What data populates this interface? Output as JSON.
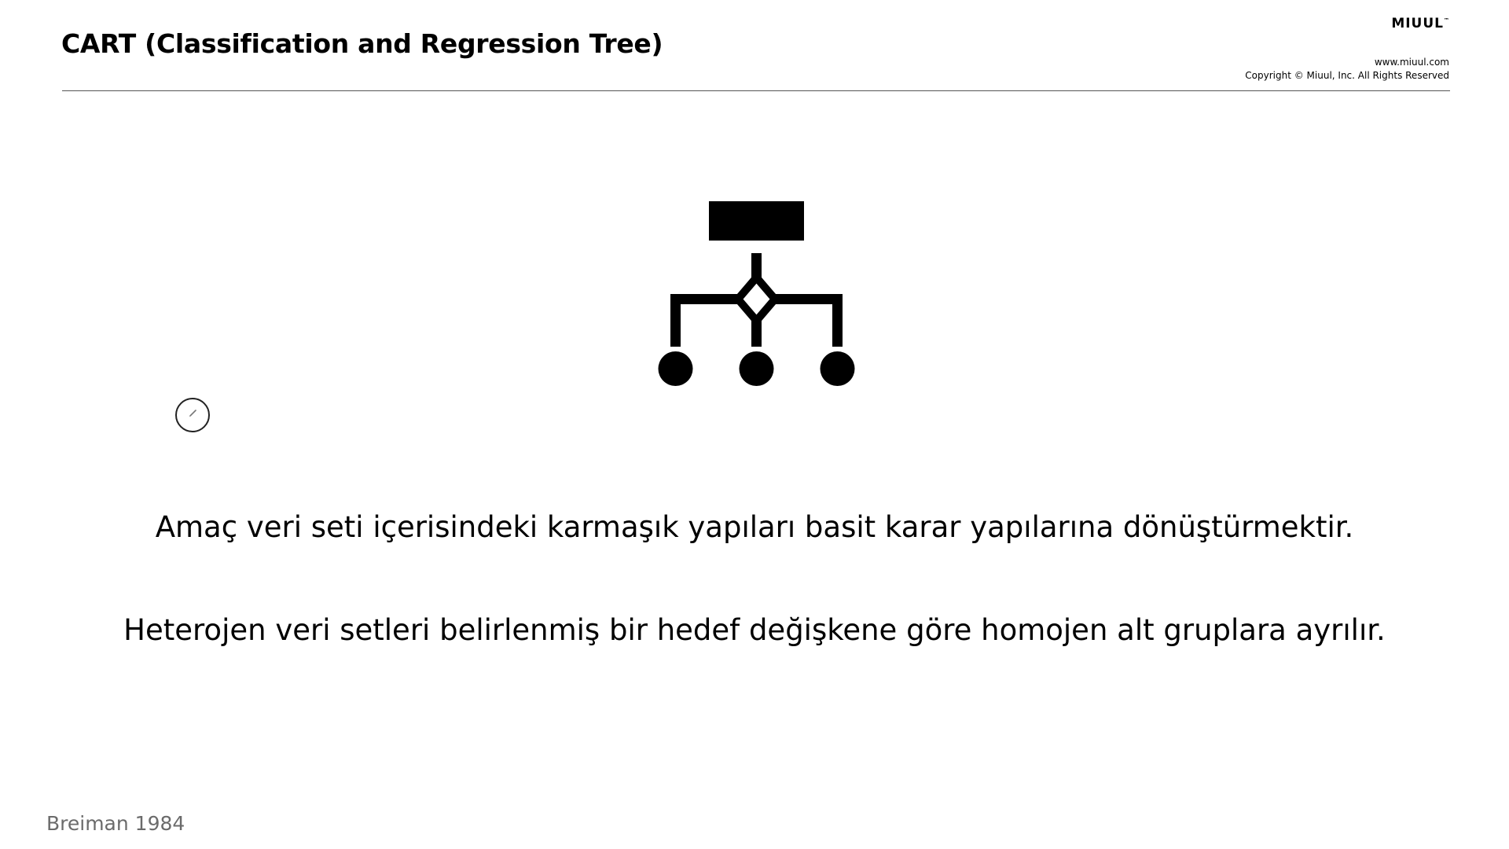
{
  "slide": {
    "title": "CART (Classification and Regression Tree)",
    "brand": "MIUUL",
    "trademark": "™",
    "website": "www.miuul.com",
    "copyright": "Copyright © Miuul, Inc. All Rights Reserved",
    "body_lines": [
      "Amaç veri seti içerisindeki karmaşık yapıları basit karar yapılarına dönüştürmektir.",
      "Heterojen veri setleri belirlenmiş bir hedef değişkene göre homojen alt gruplara ayrılır."
    ],
    "source": "Breiman 1984"
  },
  "icons": {
    "main": "decision-tree-icon",
    "cursor": "pen-cursor-icon"
  },
  "colors": {
    "text": "#000000",
    "muted": "#6b6b6b",
    "divider": "#555555",
    "background": "#ffffff"
  }
}
